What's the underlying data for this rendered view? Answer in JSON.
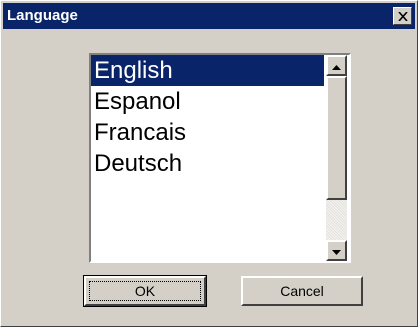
{
  "window": {
    "title": "Language"
  },
  "language_list": {
    "items": [
      "English",
      "Espanol",
      "Francais",
      "Deutsch"
    ],
    "selected": "English"
  },
  "buttons": {
    "ok_label": "OK",
    "cancel_label": "Cancel"
  },
  "icons": {
    "close": "close-icon",
    "scroll_up": "arrow-up-icon",
    "scroll_down": "arrow-down-icon"
  },
  "colors": {
    "titlebar": "#0a246a",
    "selection": "#0a246a",
    "face": "#d4d0c8"
  }
}
